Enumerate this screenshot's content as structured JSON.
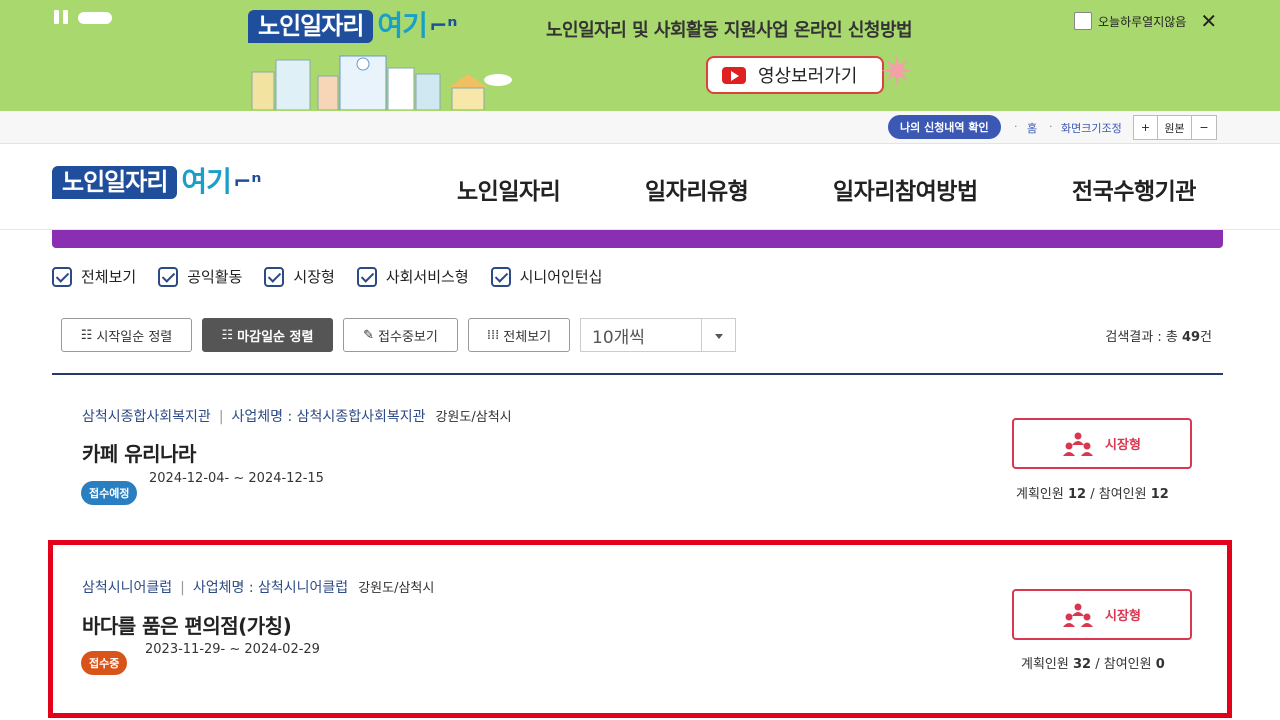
{
  "banner": {
    "logo_main": "노인일자리",
    "logo_sub": "여기",
    "title": "노인일자리 및 사회활동 지원사업 온라인 신청방법",
    "video_button": "영상보러가기",
    "no_show_today": "오늘하루열지않음",
    "close_symbol": "✕"
  },
  "utility": {
    "my_application": "나의 신청내역 확인",
    "home": "홈",
    "font_resize": "화면크기조정",
    "zoom_in": "+",
    "original": "원본",
    "zoom_out": "−"
  },
  "header": {
    "logo_main": "노인일자리",
    "logo_sub": "여기",
    "nav": [
      "노인일자리",
      "일자리유형",
      "일자리참여방법",
      "전국수행기관"
    ]
  },
  "filters": [
    "전체보기",
    "공익활동",
    "시장형",
    "사회서비스형",
    "시니어인턴십"
  ],
  "sort": {
    "buttons": [
      "시작일순 정렬",
      "마감일순 정렬",
      "접수중보기",
      "전체보기"
    ],
    "active_index": 1,
    "page_size": "10개씩"
  },
  "result": {
    "prefix": "검색결과 : 총 ",
    "count": "49",
    "suffix": "건"
  },
  "jobs": [
    {
      "org": "삼척시종합사회복지관",
      "separator": "|",
      "business": "사업체명 : 삼척시종합사회복지관",
      "region": "강원도/삼척시",
      "title": "카페 유리나라",
      "dates": "2024-12-04- ~ 2024-12-15",
      "status": "접수예정",
      "type": "시장형",
      "planned_label": "계획인원",
      "planned": "12",
      "participants_label": "참여인원",
      "participants": "12"
    },
    {
      "org": "삼척시니어클럽",
      "separator": "|",
      "business": "사업체명 : 삼척시니어클럽",
      "region": "강원도/삼척시",
      "title": "바다를 품은 편의점(가칭)",
      "dates": "2023-11-29- ~ 2024-02-29",
      "status": "접수중",
      "type": "시장형",
      "planned_label": "계획인원",
      "planned": "32",
      "participants_label": "참여인원",
      "participants": "0"
    }
  ],
  "colors": {
    "banner_bg": "#a8d86e",
    "brand_blue": "#1f4e9c",
    "purple_bar": "#8a2fb2",
    "market_type": "#d9364f",
    "highlight": "#e3001b",
    "badge_upcoming": "#2a7fc0",
    "badge_open": "#d8541a"
  }
}
